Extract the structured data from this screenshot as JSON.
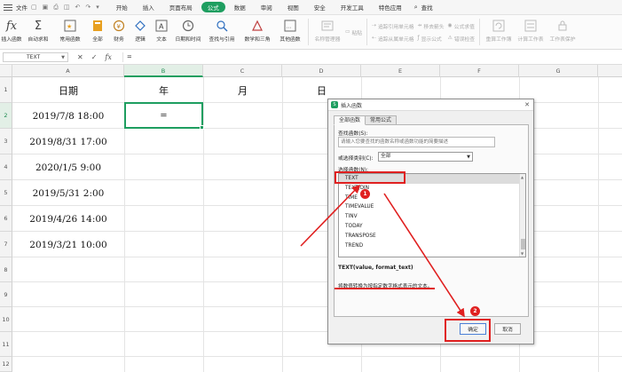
{
  "menubar": {
    "file_label": "文件",
    "tabs": [
      {
        "label": "开始"
      },
      {
        "label": "插入"
      },
      {
        "label": "页面布局"
      },
      {
        "label": "公式",
        "active": true
      },
      {
        "label": "数据"
      },
      {
        "label": "审阅"
      },
      {
        "label": "视图"
      },
      {
        "label": "安全"
      },
      {
        "label": "开发工具"
      },
      {
        "label": "特色应用"
      }
    ],
    "search_label": "查找"
  },
  "ribbon": {
    "insert_function": "插入函数",
    "autosum": "自动求和",
    "common_functions": "常用函数",
    "all": "全部",
    "finance": "财务",
    "logic": "逻辑",
    "text": "文本",
    "datetime": "日期和时间",
    "lookup": "查找与引用",
    "math": "数学和三角",
    "other_functions": "其他函数",
    "name_manager": "名称管理器",
    "paste": "粘贴",
    "trace_precedents": "追踪引用单元格",
    "trace_dependents": "追踪从属单元格",
    "remove_arrows": "移去箭头",
    "show_formulas": "显示公式",
    "formula_eval": "公式求值",
    "error_check": "错误检查",
    "recalc_workbook": "重算工作簿",
    "calc_sheet": "计算工作表",
    "calc_options": "工作表保护"
  },
  "formula_bar": {
    "name_box": "TEXT",
    "cancel_glyph": "✕",
    "enter_glyph": "✓",
    "fx_glyph": "fx",
    "value": "="
  },
  "sheet": {
    "columns": [
      "A",
      "B",
      "C",
      "D",
      "E",
      "F",
      "G"
    ],
    "rows": [
      "1",
      "2",
      "3",
      "4",
      "5",
      "6",
      "7",
      "8",
      "9",
      "10",
      "11",
      "12"
    ],
    "headers": {
      "a1": "日期",
      "b1": "年",
      "c1": "月",
      "d1": "日"
    },
    "dates": [
      "2019/7/8  18:00",
      "2019/8/31  17:00",
      "2020/1/5  9:00",
      "2019/5/31  2:00",
      "2019/4/26  14:00",
      "2019/3/21  10:00"
    ],
    "active_cell": "B2",
    "active_value": "="
  },
  "dialog": {
    "title": "插入函数",
    "close_glyph": "✕",
    "tabs": [
      {
        "label": "全部函数"
      },
      {
        "label": "常用公式"
      }
    ],
    "search_label": "查找函数(S):",
    "search_placeholder": "请输入您要查找的函数名称或函数功能的简要描述",
    "category_label": "或选择类别(C):",
    "category_value": "全部",
    "select_label": "选择函数(N):",
    "functions": [
      "TEXT",
      "TEXTJOIN",
      "TIME",
      "TIMEVALUE",
      "TINV",
      "TODAY",
      "TRANSPOSE",
      "TREND"
    ],
    "selected_function": "TEXT",
    "signature": "TEXT(value, format_text)",
    "description": "将数值转换为按指定数字格式表示的文本。",
    "ok_label": "确定",
    "cancel_label": "取消"
  },
  "annotations": {
    "badge_1": "1",
    "badge_2": "2"
  },
  "colors": {
    "accent": "#1e9e60",
    "annotation": "#e02020"
  }
}
